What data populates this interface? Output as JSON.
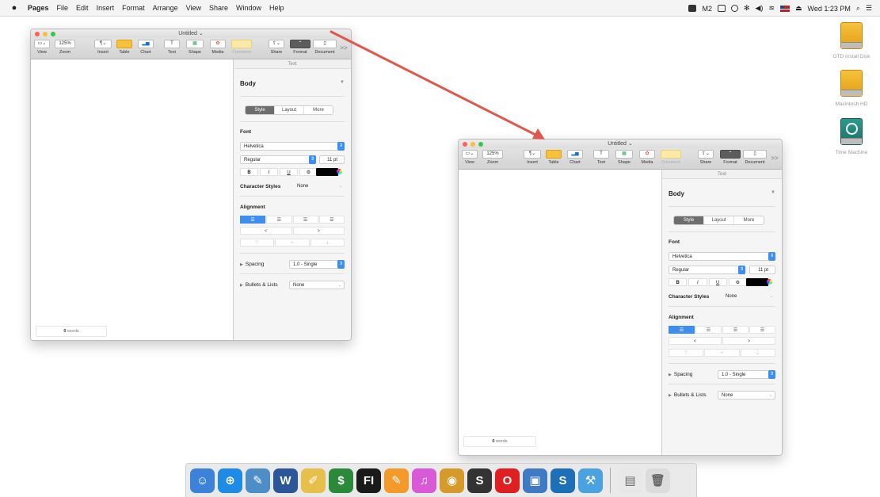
{
  "menubar": {
    "app_name": "Pages",
    "items": [
      "File",
      "Edit",
      "Insert",
      "Format",
      "Arrange",
      "View",
      "Share",
      "Window",
      "Help"
    ],
    "clock": "Wed 1:23 PM",
    "battery_text": "2"
  },
  "desktop": {
    "icons": [
      {
        "label": "OTD Install Disk",
        "icon": "external-drive-icon"
      },
      {
        "label": "Macintosh HD",
        "icon": "hard-disk-icon"
      },
      {
        "label": "Time Machine",
        "icon": "time-machine-drive-icon"
      }
    ]
  },
  "window": {
    "title": "Untitled",
    "toolbar": {
      "view": "View",
      "zoom": "Zoom",
      "zoom_value": "125%",
      "insert": "Insert",
      "table": "Table",
      "chart": "Chart",
      "text": "Text",
      "shape": "Shape",
      "media": "Media",
      "comment": "Comment",
      "share": "Share",
      "format": "Format",
      "document": "Document",
      "overflow": ">>"
    },
    "word_count": "0",
    "word_count_label": "words",
    "sidebar": {
      "tab": "Text",
      "paragraph_style": "Body",
      "segments": [
        "Style",
        "Layout",
        "More"
      ],
      "font_label": "Font",
      "font_name": "Helvetica",
      "font_weight": "Regular",
      "font_size": "11 pt",
      "format_buttons": [
        "B",
        "I",
        "U",
        "⚙"
      ],
      "character_styles_label": "Character Styles",
      "character_styles_value": "None",
      "alignment_label": "Alignment",
      "indent_decrease": "<",
      "indent_increase": ">",
      "spacing_label": "Spacing",
      "spacing_value": "1.0 - Single",
      "bullets_label": "Bullets & Lists",
      "bullets_value": "None"
    }
  },
  "dock": {
    "apps": [
      {
        "name": "Finder",
        "icon": "finder-icon",
        "color": "#3c82d8",
        "glyph": "☺"
      },
      {
        "name": "Safari",
        "icon": "safari-icon",
        "color": "#1e8be6",
        "glyph": "⊕"
      },
      {
        "name": "Preview",
        "icon": "preview-icon",
        "color": "#4d8ec9",
        "glyph": "✎"
      },
      {
        "name": "Word",
        "icon": "word-icon",
        "color": "#2b579a",
        "glyph": "W"
      },
      {
        "name": "Notes",
        "icon": "notes-icon",
        "color": "#e6c04a",
        "glyph": "✐"
      },
      {
        "name": "Script",
        "icon": "script-icon",
        "color": "#2a8a3a",
        "glyph": "$"
      },
      {
        "name": "FI",
        "icon": "fi-icon",
        "color": "#1a1a1a",
        "glyph": "FI"
      },
      {
        "name": "Pages",
        "icon": "pages-icon",
        "color": "#f39a2a",
        "glyph": "✎"
      },
      {
        "name": "iTunes",
        "icon": "itunes-icon",
        "color": "#d85ad6",
        "glyph": "♫"
      },
      {
        "name": "PDF",
        "icon": "pdf-icon",
        "color": "#d69a2a",
        "glyph": "◉"
      },
      {
        "name": "S",
        "icon": "s-app-icon",
        "color": "#333333",
        "glyph": "S"
      },
      {
        "name": "Opera",
        "icon": "opera-icon",
        "color": "#e02020",
        "glyph": "O"
      },
      {
        "name": "Image Capture",
        "icon": "image-capture-icon",
        "color": "#3f7ac4",
        "glyph": "▣"
      },
      {
        "name": "Sigil",
        "icon": "s-blue-icon",
        "color": "#1d6fb8",
        "glyph": "S"
      },
      {
        "name": "Xcode",
        "icon": "xcode-icon",
        "color": "#4aa3e0",
        "glyph": "⚒"
      },
      {
        "name": "Document",
        "icon": "document-icon",
        "color": "#e8e8e8",
        "glyph": "▤"
      },
      {
        "name": "Trash",
        "icon": "trash-icon",
        "color": "#dcdcdc",
        "glyph": "🗑"
      }
    ]
  },
  "colors": {
    "accent_blue": "#3d8ef0",
    "arrow_red": "#e0584c"
  }
}
